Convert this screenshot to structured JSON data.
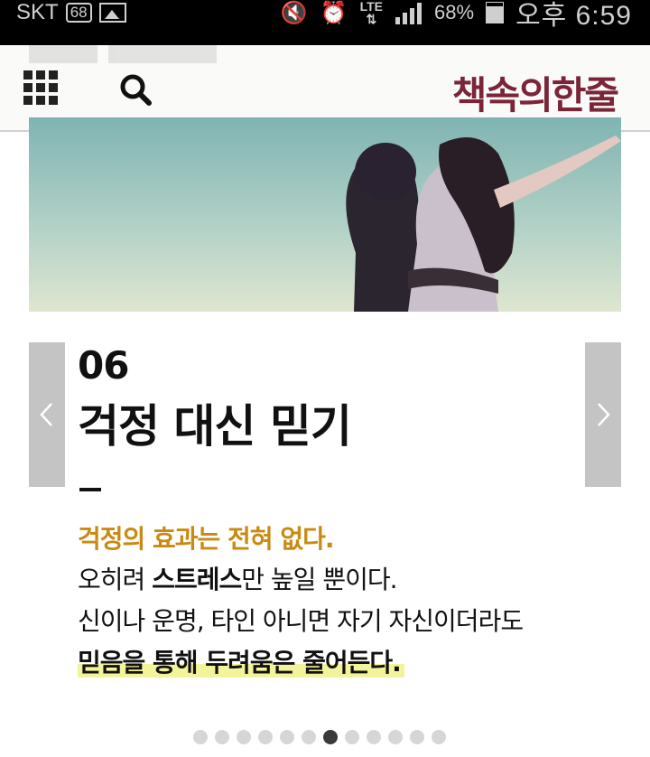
{
  "status_bar": {
    "carrier": "SKT",
    "badge": "68",
    "lte": "LTE",
    "battery": "68%",
    "time": "오후 6:59"
  },
  "header": {
    "brand": "책속의한줄"
  },
  "card": {
    "number": "06",
    "headline": "걱정 대신 믿기",
    "line1": "걱정의 효과는 전혀 없다.",
    "line2_a": "오히려 ",
    "line2_bold": "스트레스",
    "line2_b": "만 높일 뿐이다.",
    "line3": "신이나 운명, 타인 아니면 자기 자신이더라도",
    "line4": "믿음을 통해 두려움은 줄어든다."
  },
  "pager": {
    "total": 12,
    "active_index": 6
  },
  "colors": {
    "brand": "#7a2638",
    "lead_line": "#c98a12",
    "highlight": "#f3f39a",
    "nav_bg": "#c4c4c4"
  }
}
